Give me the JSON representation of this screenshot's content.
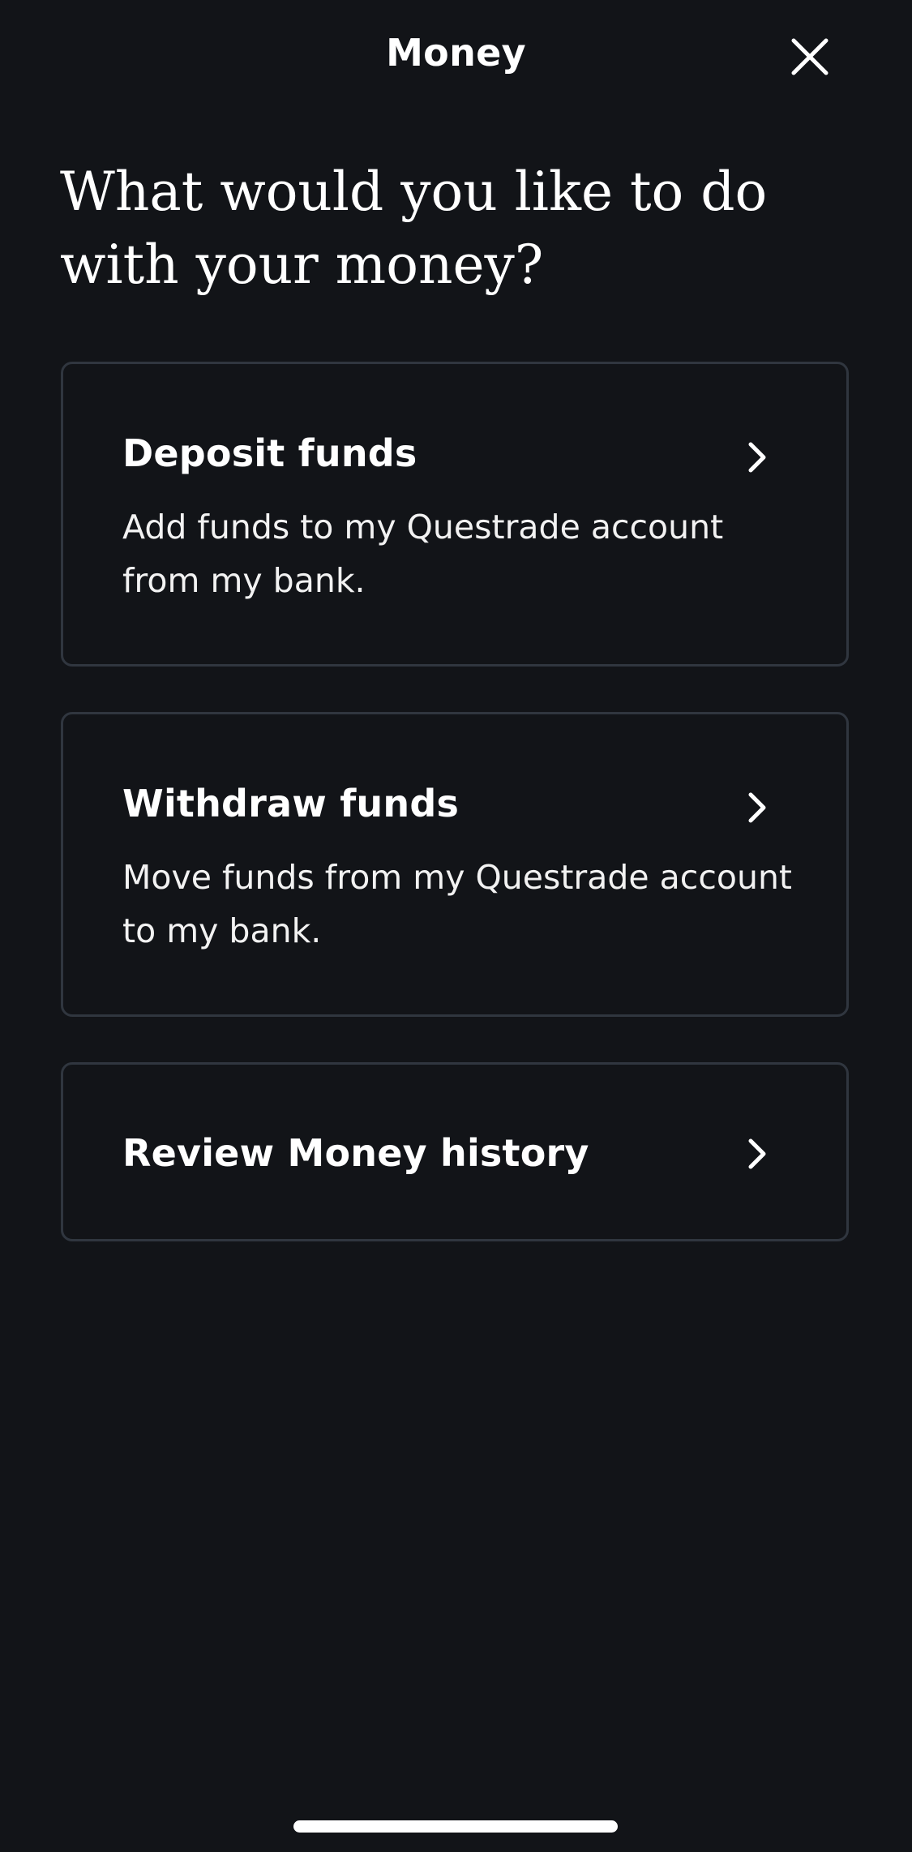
{
  "header": {
    "title": "Money",
    "close_icon": "close-icon"
  },
  "heading": "What would you like to do with your money?",
  "options": [
    {
      "title": "Deposit funds",
      "description": "Add funds to my Questrade account from my bank.",
      "icon": "chevron-right-icon"
    },
    {
      "title": "Withdraw funds",
      "description": "Move funds from my Questrade account to my bank.",
      "icon": "chevron-right-icon"
    },
    {
      "title": "Review Money history",
      "icon": "chevron-right-icon"
    }
  ],
  "colors": {
    "background": "#121418",
    "card_border": "#30363f",
    "text": "#ffffff"
  }
}
